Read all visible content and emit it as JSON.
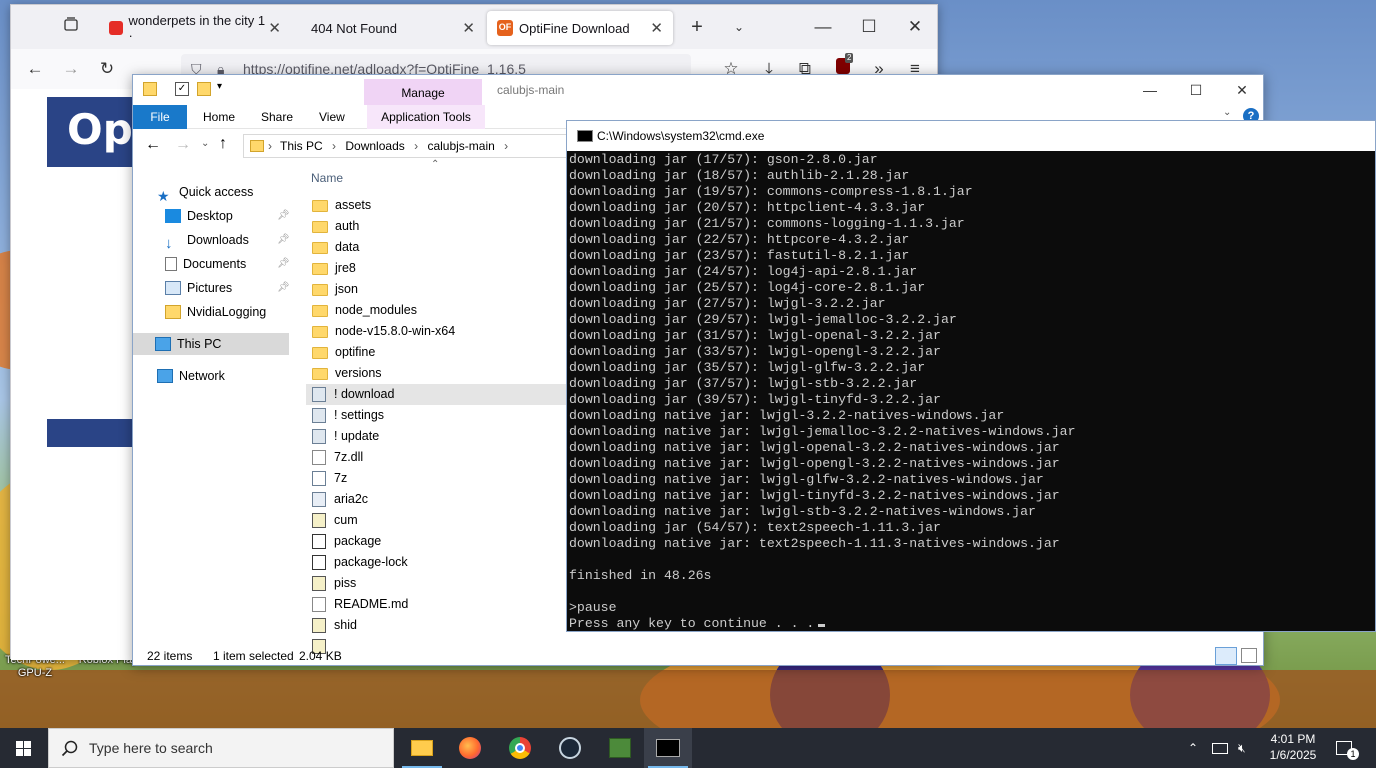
{
  "desktop": {
    "icons": [
      {
        "label": "TechPowe... GPU-Z"
      },
      {
        "label": "Roblox Player"
      }
    ]
  },
  "browser": {
    "tabs": [
      {
        "label": "wonderpets in the city 1 ·"
      },
      {
        "label": "404 Not Found"
      },
      {
        "label": "OptiFine Download",
        "favicon_text": "OF"
      }
    ],
    "new_tab": "+",
    "url": "https://optifine.net/adloadx?f=OptiFine_1.16.5",
    "extension_badge": "2",
    "page_logo": "Opti"
  },
  "explorer": {
    "title": "calubjs-main",
    "context_tab": "Manage",
    "ribbon_tabs": [
      "File",
      "Home",
      "Share",
      "View",
      "Application Tools"
    ],
    "breadcrumb": [
      "This PC",
      "Downloads",
      "calubjs-main"
    ],
    "column_name": "Name",
    "nav": {
      "quick_access": "Quick access",
      "desktop": "Desktop",
      "downloads": "Downloads",
      "documents": "Documents",
      "pictures": "Pictures",
      "nvidia": "NvidiaLogging",
      "this_pc": "This PC",
      "network": "Network"
    },
    "files": [
      {
        "name": "assets",
        "type": "folder"
      },
      {
        "name": "auth",
        "type": "folder"
      },
      {
        "name": "data",
        "type": "folder"
      },
      {
        "name": "jre8",
        "type": "folder"
      },
      {
        "name": "json",
        "type": "folder"
      },
      {
        "name": "node_modules",
        "type": "folder"
      },
      {
        "name": "node-v15.8.0-win-x64",
        "type": "folder"
      },
      {
        "name": "optifine",
        "type": "folder"
      },
      {
        "name": "versions",
        "type": "folder"
      },
      {
        "name": "! download",
        "type": "bat"
      },
      {
        "name": "! settings",
        "type": "bat"
      },
      {
        "name": "! update",
        "type": "bat"
      },
      {
        "name": "7z.dll",
        "type": "doc"
      },
      {
        "name": "7z",
        "type": "exe"
      },
      {
        "name": "aria2c",
        "type": "exe"
      },
      {
        "name": "cum",
        "type": "js"
      },
      {
        "name": "package",
        "type": "json"
      },
      {
        "name": "package-lock",
        "type": "json"
      },
      {
        "name": "piss",
        "type": "js"
      },
      {
        "name": "README.md",
        "type": "doc"
      },
      {
        "name": "shid",
        "type": "js"
      }
    ],
    "status": {
      "items": "22 items",
      "selected": "1 item selected",
      "size": "2.04 KB"
    }
  },
  "cmd": {
    "title": "C:\\Windows\\system32\\cmd.exe",
    "lines": [
      "downloading jar (17/57): gson-2.8.0.jar",
      "downloading jar (18/57): authlib-2.1.28.jar",
      "downloading jar (19/57): commons-compress-1.8.1.jar",
      "downloading jar (20/57): httpclient-4.3.3.jar",
      "downloading jar (21/57): commons-logging-1.1.3.jar",
      "downloading jar (22/57): httpcore-4.3.2.jar",
      "downloading jar (23/57): fastutil-8.2.1.jar",
      "downloading jar (24/57): log4j-api-2.8.1.jar",
      "downloading jar (25/57): log4j-core-2.8.1.jar",
      "downloading jar (27/57): lwjgl-3.2.2.jar",
      "downloading jar (29/57): lwjgl-jemalloc-3.2.2.jar",
      "downloading jar (31/57): lwjgl-openal-3.2.2.jar",
      "downloading jar (33/57): lwjgl-opengl-3.2.2.jar",
      "downloading jar (35/57): lwjgl-glfw-3.2.2.jar",
      "downloading jar (37/57): lwjgl-stb-3.2.2.jar",
      "downloading jar (39/57): lwjgl-tinyfd-3.2.2.jar",
      "downloading native jar: lwjgl-3.2.2-natives-windows.jar",
      "downloading native jar: lwjgl-jemalloc-3.2.2-natives-windows.jar",
      "downloading native jar: lwjgl-openal-3.2.2-natives-windows.jar",
      "downloading native jar: lwjgl-opengl-3.2.2-natives-windows.jar",
      "downloading native jar: lwjgl-glfw-3.2.2-natives-windows.jar",
      "downloading native jar: lwjgl-tinyfd-3.2.2-natives-windows.jar",
      "downloading native jar: lwjgl-stb-3.2.2-natives-windows.jar",
      "downloading jar (54/57): text2speech-1.11.3.jar",
      "downloading native jar: text2speech-1.11.3-natives-windows.jar",
      "",
      "finished in 48.26s",
      "",
      ">pause",
      "Press any key to continue . . ."
    ]
  },
  "taskbar": {
    "search_placeholder": "Type here to search",
    "time": "4:01 PM",
    "date": "1/6/2025",
    "notification_count": "1"
  }
}
